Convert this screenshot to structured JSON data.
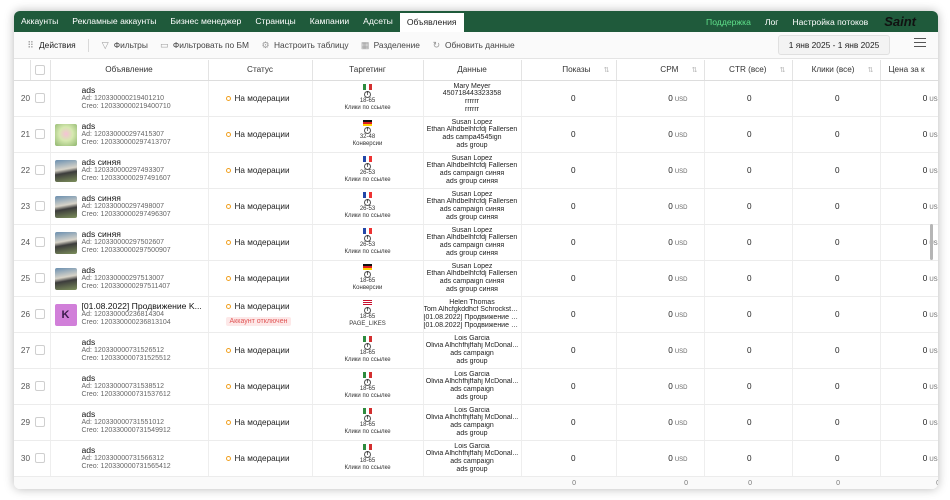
{
  "nav": {
    "tabs": [
      "Аккаунты",
      "Рекламные аккаунты",
      "Бизнес менеджер",
      "Страницы",
      "Кампании",
      "Адсеты",
      "Объявления"
    ],
    "active": 6,
    "support": "Поддержка",
    "log": "Лог",
    "flow_settings": "Настройка потоков",
    "logo": "Saint"
  },
  "toolbar": {
    "actions": "Действия",
    "filters": "Фильтры",
    "filter_bm": "Фильтровать по БМ",
    "table_settings": "Настроить таблицу",
    "split": "Разделение",
    "refresh": "Обновить данные",
    "date_range": "1 янв 2025 - 1 янв 2025"
  },
  "columns": {
    "ad": "Объявление",
    "status": "Статус",
    "targeting": "Таргетинг",
    "data": "Данные",
    "impressions": "Показы",
    "cpm": "CPM",
    "ctr": "CTR (все)",
    "clicks": "Клики (все)",
    "price": "Цена за к"
  },
  "currency": "USD",
  "totals": [
    "0",
    "0",
    "0",
    "0",
    "0"
  ],
  "rows": [
    {
      "idx": "20",
      "thumb": "p1",
      "name": "ads",
      "ad_id": "Ad: 120330000219401210",
      "creo": "Creo: 120330000219400710",
      "status": "На модерации",
      "flag": "mx",
      "age": "18-65",
      "goal": "Клики по ссылке",
      "d1": "Mary Meyer",
      "d2": "450718443323358",
      "d3": "rrrrrr",
      "d4": "rrrrrr",
      "imp": "0",
      "cpm": "0",
      "ctr": "0",
      "clicks": "0",
      "price": "0"
    },
    {
      "idx": "21",
      "thumb": "p2",
      "name": "ads",
      "ad_id": "Ad: 120330000297415307",
      "creo": "Creo: 120330000297413707",
      "status": "На модерации",
      "flag": "de",
      "age": "32-48",
      "goal": "Конверсии",
      "d1": "Susan Lopez",
      "d2": "Ethan Alhdbelhfcfdj Fallersen",
      "d3": "ads campa4545ign",
      "d4": "ads group",
      "imp": "0",
      "cpm": "0",
      "ctr": "0",
      "clicks": "0",
      "price": "0"
    },
    {
      "idx": "22",
      "thumb": "p3",
      "name": "ads синяя",
      "ad_id": "Ad: 120330000297493307",
      "creo": "Creo: 120330000297491607",
      "status": "На модерации",
      "flag": "fr",
      "age": "26-53",
      "goal": "Клики по ссылке",
      "d1": "Susan Lopez",
      "d2": "Ethan Alhdbelhfcfdj Fallersen",
      "d3": "ads campaign синяя",
      "d4": "ads group синяя",
      "imp": "0",
      "cpm": "0",
      "ctr": "0",
      "clicks": "0",
      "price": "0"
    },
    {
      "idx": "23",
      "thumb": "p3",
      "name": "ads синяя",
      "ad_id": "Ad: 120330000297498007",
      "creo": "Creo: 120330000297496307",
      "status": "На модерации",
      "flag": "fr",
      "age": "26-53",
      "goal": "Клики по ссылке",
      "d1": "Susan Lopez",
      "d2": "Ethan Alhdbelhfcfdj Fallersen",
      "d3": "ads campaign синяя",
      "d4": "ads group синяя",
      "imp": "0",
      "cpm": "0",
      "ctr": "0",
      "clicks": "0",
      "price": "0"
    },
    {
      "idx": "24",
      "thumb": "p3",
      "name": "ads синяя",
      "ad_id": "Ad: 120330000297502607",
      "creo": "Creo: 120330000297500907",
      "status": "На модерации",
      "flag": "fr",
      "age": "26-53",
      "goal": "Клики по ссылке",
      "d1": "Susan Lopez",
      "d2": "Ethan Alhdbelhfcfdj Fallersen",
      "d3": "ads campaign синяя",
      "d4": "ads group синяя",
      "imp": "0",
      "cpm": "0",
      "ctr": "0",
      "clicks": "0",
      "price": "0"
    },
    {
      "idx": "25",
      "thumb": "p3",
      "name": "ads",
      "ad_id": "Ad: 120330000297513007",
      "creo": "Creo: 120330000297511407",
      "status": "На модерации",
      "flag": "de",
      "age": "18-65",
      "goal": "Конверсии",
      "d1": "Susan Lopez",
      "d2": "Ethan Alhdbelhfcfdj Fallersen",
      "d3": "ads campaign синяя",
      "d4": "ads group синяя",
      "imp": "0",
      "cpm": "0",
      "ctr": "0",
      "clicks": "0",
      "price": "0"
    },
    {
      "idx": "26",
      "thumb": "k",
      "thumb_letter": "K",
      "name": "[01.08.2022] Продвижение K...",
      "ad_id": "Ad: 120330000236814304",
      "creo": "Creo: 120330000236813104",
      "status": "На модерации",
      "badge": "Аккаунт отключен",
      "flag": "us",
      "age": "18-65",
      "goal": "PAGE_LIKES",
      "d1": "Helen Thomas",
      "d2": "Tom Alhcfgkddhcf Schrockste...",
      "d3": "[01.08.2022] Продвижение K...",
      "d4": "[01.08.2022] Продвижение K...",
      "imp": "0",
      "cpm": "0",
      "ctr": "0",
      "clicks": "0",
      "price": "0"
    },
    {
      "idx": "27",
      "thumb": "p1",
      "name": "ads",
      "ad_id": "Ad: 120330000731526512",
      "creo": "Creo: 120330000731525512",
      "status": "На модерации",
      "flag": "mx",
      "age": "18-65",
      "goal": "Клики по ссылке",
      "d1": "Lois Garcia",
      "d2": "Olivia Alhchfhjffahj McDonal...",
      "d3": "ads campaign",
      "d4": "ads group",
      "imp": "0",
      "cpm": "0",
      "ctr": "0",
      "clicks": "0",
      "price": "0"
    },
    {
      "idx": "28",
      "thumb": "p1",
      "name": "ads",
      "ad_id": "Ad: 120330000731538512",
      "creo": "Creo: 120330000731537612",
      "status": "На модерации",
      "flag": "mx",
      "age": "18-65",
      "goal": "Клики по ссылке",
      "d1": "Lois Garcia",
      "d2": "Olivia Alhchfhjffahj McDonal...",
      "d3": "ads campaign",
      "d4": "ads group",
      "imp": "0",
      "cpm": "0",
      "ctr": "0",
      "clicks": "0",
      "price": "0"
    },
    {
      "idx": "29",
      "thumb": "p1",
      "name": "ads",
      "ad_id": "Ad: 120330000731551012",
      "creo": "Creo: 120330000731549912",
      "status": "На модерации",
      "flag": "mx",
      "age": "18-65",
      "goal": "Клики по ссылке",
      "d1": "Lois Garcia",
      "d2": "Olivia Alhchfhjffahj McDonal...",
      "d3": "ads campaign",
      "d4": "ads group",
      "imp": "0",
      "cpm": "0",
      "ctr": "0",
      "clicks": "0",
      "price": "0"
    },
    {
      "idx": "30",
      "thumb": "p1",
      "name": "ads",
      "ad_id": "Ad: 120330000731566312",
      "creo": "Creo: 120330000731565412",
      "status": "На модерации",
      "flag": "mx",
      "age": "18-65",
      "goal": "Клики по ссылке",
      "d1": "Lois Garcia",
      "d2": "Olivia Alhchfhjffahj McDonal...",
      "d3": "ads campaign",
      "d4": "ads group",
      "imp": "0",
      "cpm": "0",
      "ctr": "0",
      "clicks": "0",
      "price": "0"
    }
  ]
}
